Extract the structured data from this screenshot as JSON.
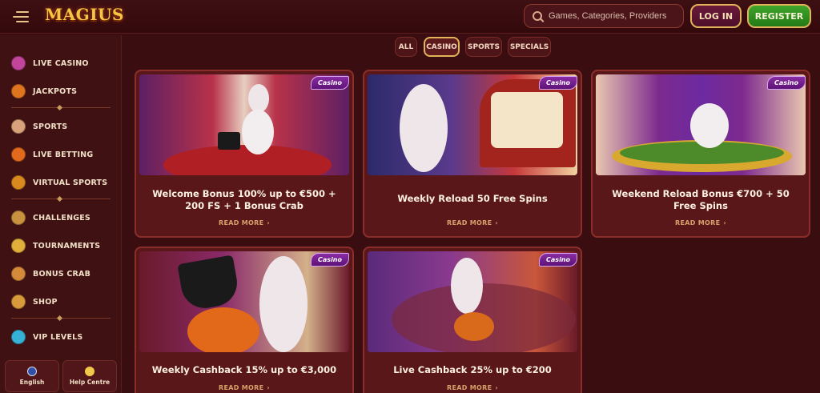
{
  "header": {
    "logo": "MAGIUS",
    "search_placeholder": "Games, Categories, Providers",
    "login_label": "LOG IN",
    "register_label": "REGISTER"
  },
  "sidebar": {
    "items": [
      {
        "label": "LIVE CASINO",
        "icon": "live-casino-icon",
        "color": "#c2459b"
      },
      {
        "label": "JACKPOTS",
        "icon": "jackpots-icon",
        "color": "#e0751f"
      },
      {
        "label": "SPORTS",
        "icon": "sports-icon",
        "color": "#d9a27a"
      },
      {
        "label": "LIVE BETTING",
        "icon": "live-betting-icon",
        "color": "#e36a1c"
      },
      {
        "label": "VIRTUAL SPORTS",
        "icon": "virtual-sports-icon",
        "color": "#d9891d"
      },
      {
        "label": "CHALLENGES",
        "icon": "challenges-icon",
        "color": "#c9923f"
      },
      {
        "label": "TOURNAMENTS",
        "icon": "tournaments-icon",
        "color": "#e0b03a"
      },
      {
        "label": "BONUS CRAB",
        "icon": "bonus-crab-icon",
        "color": "#d58a3a"
      },
      {
        "label": "SHOP",
        "icon": "shop-icon",
        "color": "#d99a3b"
      },
      {
        "label": "VIP LEVELS",
        "icon": "vip-levels-icon",
        "color": "#36b2d6"
      }
    ],
    "language_label": "English",
    "help_label": "Help Centre"
  },
  "filters": [
    {
      "label": "ALL",
      "active": false
    },
    {
      "label": "CASINO",
      "active": true
    },
    {
      "label": "SPORTS",
      "active": false
    },
    {
      "label": "SPECIALS",
      "active": false
    }
  ],
  "cards": [
    {
      "badge": "Casino",
      "title": "Welcome Bonus 100% up to €500 + 200 FS + 1 Bonus Crab",
      "more": "READ MORE"
    },
    {
      "badge": "Casino",
      "title": "Weekly Reload 50 Free Spins",
      "more": "READ MORE"
    },
    {
      "badge": "Casino",
      "title": "Weekend Reload Bonus €700 + 50 Free Spins",
      "more": "READ MORE"
    },
    {
      "badge": "Casino",
      "title": "Weekly Cashback 15% up to €3,000",
      "more": "READ MORE"
    },
    {
      "badge": "Casino",
      "title": "Live Cashback 25% up to €200",
      "more": "READ MORE"
    }
  ]
}
